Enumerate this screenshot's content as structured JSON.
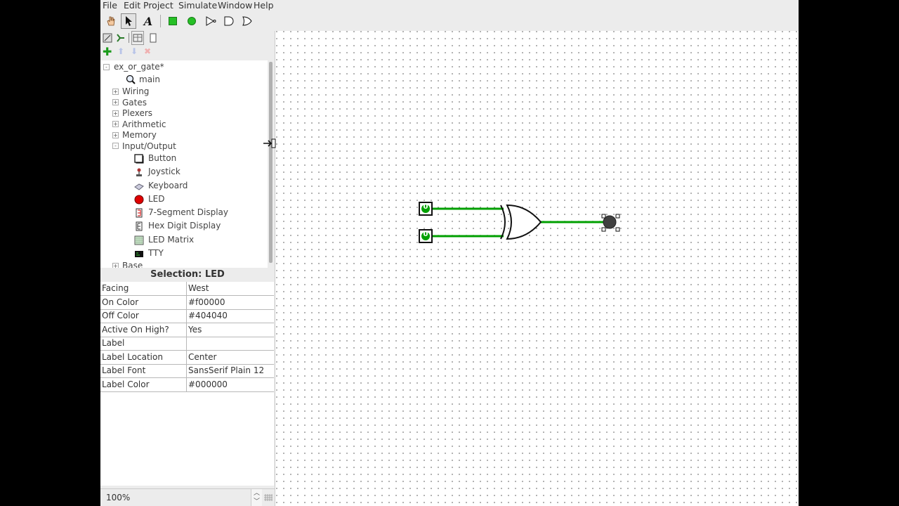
{
  "menu": [
    "File",
    "Edit",
    "Project",
    "Simulate",
    "Window",
    "Help"
  ],
  "toolbar": {
    "tools": [
      "hand-poke-tool-icon",
      "select-tool-icon",
      "text-tool-icon",
      "input-pin-icon",
      "output-pin-icon",
      "not-gate-icon",
      "and-gate-icon",
      "or-gate-icon"
    ],
    "text_tool_glyph": "A"
  },
  "tree": {
    "project": "ex_or_gate*",
    "main": "main",
    "libraries": [
      "Wiring",
      "Gates",
      "Plexers",
      "Arithmetic",
      "Memory",
      "Input/Output"
    ],
    "io_items": [
      "Button",
      "Joystick",
      "Keyboard",
      "LED",
      "7-Segment Display",
      "Hex Digit Display",
      "LED Matrix",
      "TTY"
    ],
    "last": "Base",
    "expand": "+",
    "collapse": "-"
  },
  "selection_title": "Selection: LED",
  "attributes": [
    {
      "key": "Facing",
      "value": "West"
    },
    {
      "key": "On Color",
      "value": "#f00000"
    },
    {
      "key": "Off Color",
      "value": "#404040"
    },
    {
      "key": "Active On High?",
      "value": "Yes"
    },
    {
      "key": "Label",
      "value": ""
    },
    {
      "key": "Label Location",
      "value": "Center"
    },
    {
      "key": "Label Font",
      "value": "SansSerif Plain 12"
    },
    {
      "key": "Label Color",
      "value": "#000000"
    }
  ],
  "zoom": "100%",
  "circuit": {
    "pin_a_value": "0",
    "pin_b_value": "0",
    "wire_color": "#00a000",
    "gate": "xor",
    "led_off_color": "#404040"
  }
}
